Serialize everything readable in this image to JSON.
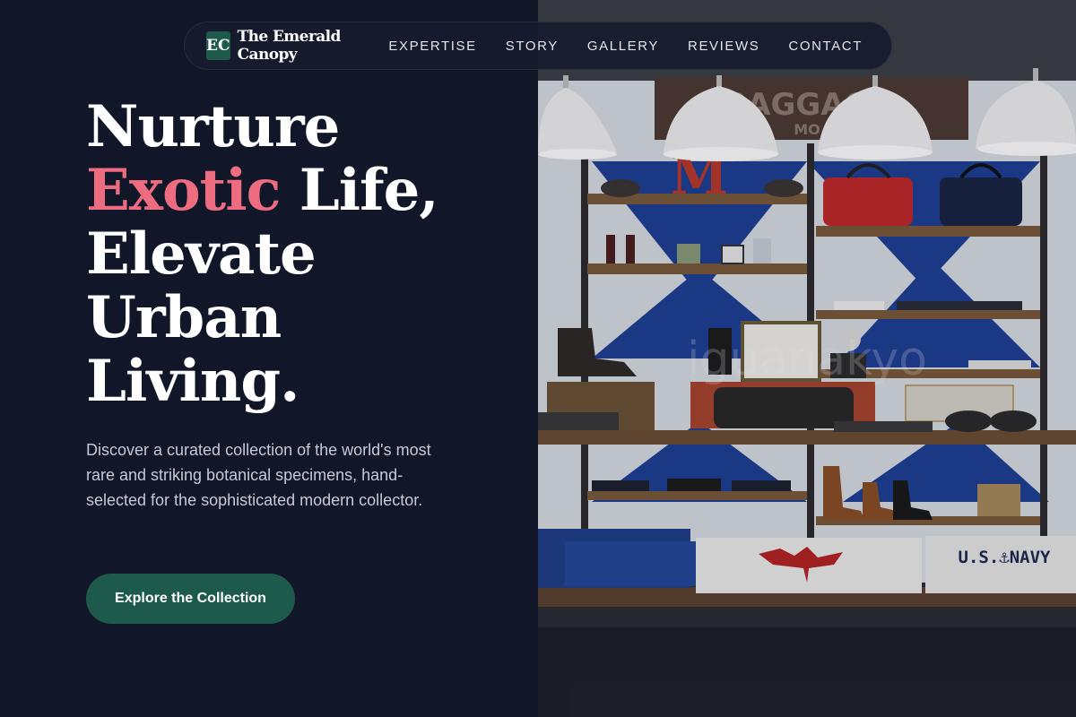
{
  "brand": {
    "mark": "EC",
    "name": "The Emerald Canopy"
  },
  "nav": {
    "links": [
      "EXPERTISE",
      "STORY",
      "GALLERY",
      "REVIEWS",
      "CONTACT"
    ]
  },
  "hero": {
    "title_line1": "Nurture",
    "title_accent": "Exotic",
    "title_line2_rest": " Life,",
    "title_line3": "Elevate",
    "title_line4": "Urban",
    "title_line5": "Living.",
    "description": "Discover a curated collection of the world's most rare and striking botanical specimens, hand-selected for the sophisticated modern collector.",
    "cta_label": "Explore the Collection"
  },
  "image": {
    "sign_text": "BAGGAGE",
    "sign_subtext": "MO",
    "letter": "M",
    "watermark": "iguanakyo",
    "flag_text": "U.S.⚓NAVY"
  },
  "colors": {
    "background": "#111729",
    "accent_pink": "#ee6c80",
    "brand_green": "#1d5a4c"
  }
}
